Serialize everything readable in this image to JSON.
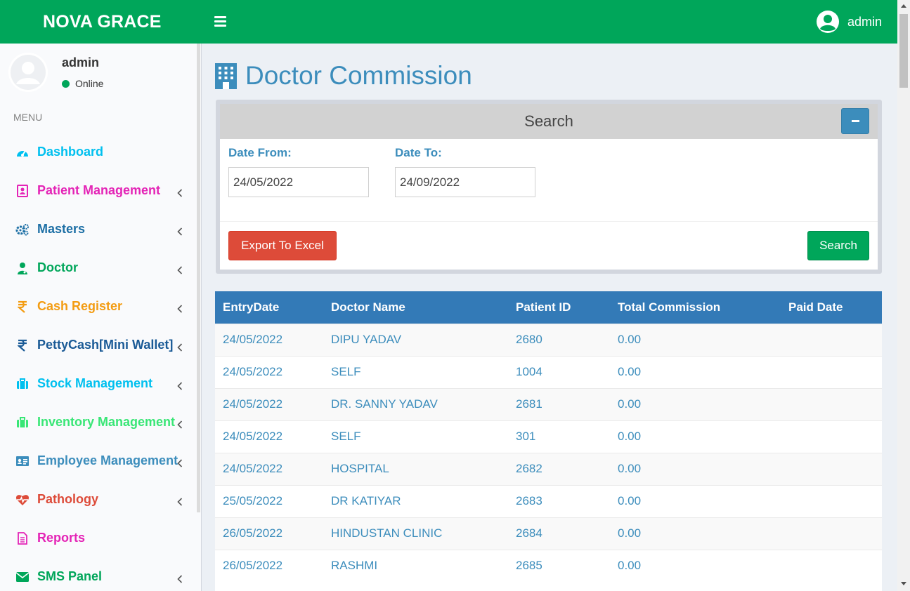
{
  "header": {
    "brand": "NOVA GRACE",
    "user": "admin",
    "accent_color": "#00a65a"
  },
  "sidebar": {
    "user": {
      "name": "admin",
      "status": "Online"
    },
    "menu_header": "MENU",
    "items": [
      {
        "label": "Dashboard",
        "icon": "dashboard-icon",
        "color": "#00c0ef",
        "has_chevron": false
      },
      {
        "label": "Patient Management",
        "icon": "patient-card-icon",
        "color": "#e424b6",
        "has_chevron": true
      },
      {
        "label": "Masters",
        "icon": "cogs-icon",
        "color": "#1d6fa5",
        "has_chevron": true
      },
      {
        "label": "Doctor",
        "icon": "doctor-icon",
        "color": "#00a65a",
        "has_chevron": true
      },
      {
        "label": "Cash Register",
        "icon": "rupee-icon",
        "color": "#f39c12",
        "has_chevron": true
      },
      {
        "label": "PettyCash[Mini Wallet]",
        "icon": "rupee-icon",
        "color": "#1a5a96",
        "has_chevron": true
      },
      {
        "label": "Stock Management",
        "icon": "briefcase-icon",
        "color": "#00c0ef",
        "has_chevron": true
      },
      {
        "label": "Inventory Management",
        "icon": "briefcase-icon",
        "color": "#39e676",
        "has_chevron": true
      },
      {
        "label": "Employee Management",
        "icon": "id-card-icon",
        "color": "#3c8dbc",
        "has_chevron": true
      },
      {
        "label": "Pathology",
        "icon": "heartbeat-icon",
        "color": "#dd4b39",
        "has_chevron": true
      },
      {
        "label": "Reports",
        "icon": "document-icon",
        "color": "#e424b6",
        "has_chevron": false
      },
      {
        "label": "SMS Panel",
        "icon": "envelope-icon",
        "color": "#00a65a",
        "has_chevron": true
      }
    ]
  },
  "page": {
    "title": "Doctor Commission",
    "title_icon": "building-icon"
  },
  "search": {
    "title": "Search",
    "date_from_label": "Date From:",
    "date_from_value": "24/05/2022",
    "date_to_label": "Date To:",
    "date_to_value": "24/09/2022",
    "export_label": "Export To Excel",
    "search_label": "Search"
  },
  "table": {
    "headers": [
      "EntryDate",
      "Doctor Name",
      "Patient ID",
      "Total Commission",
      "Paid Date"
    ],
    "rows": [
      [
        "24/05/2022",
        "DIPU YADAV",
        "2680",
        "0.00",
        ""
      ],
      [
        "24/05/2022",
        "SELF",
        "1004",
        "0.00",
        ""
      ],
      [
        "24/05/2022",
        "DR. SANNY YADAV",
        "2681",
        "0.00",
        ""
      ],
      [
        "24/05/2022",
        "SELF",
        "301",
        "0.00",
        ""
      ],
      [
        "24/05/2022",
        "HOSPITAL",
        "2682",
        "0.00",
        ""
      ],
      [
        "25/05/2022",
        "DR KATIYAR",
        "2683",
        "0.00",
        ""
      ],
      [
        "26/05/2022",
        "HINDUSTAN CLINIC",
        "2684",
        "0.00",
        ""
      ],
      [
        "26/05/2022",
        "RASHMI",
        "2685",
        "0.00",
        ""
      ]
    ]
  }
}
